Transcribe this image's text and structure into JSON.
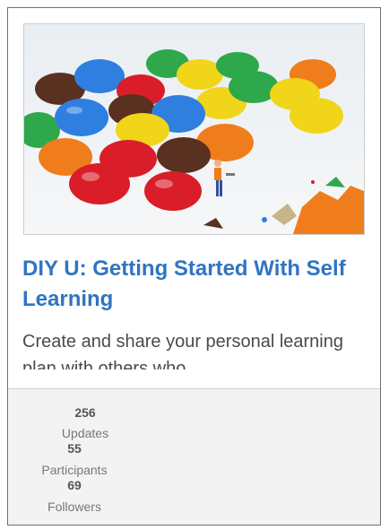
{
  "card": {
    "image_alt": "Colorful candies with miniature worker figures",
    "title": "DIY U: Getting Started With Self Learning",
    "description": "Create and share your personal learning plan with others who",
    "stats": [
      {
        "value": "256",
        "label": "Updates"
      },
      {
        "value": "55",
        "label": "Participants"
      },
      {
        "value": "69",
        "label": "Followers"
      }
    ]
  }
}
